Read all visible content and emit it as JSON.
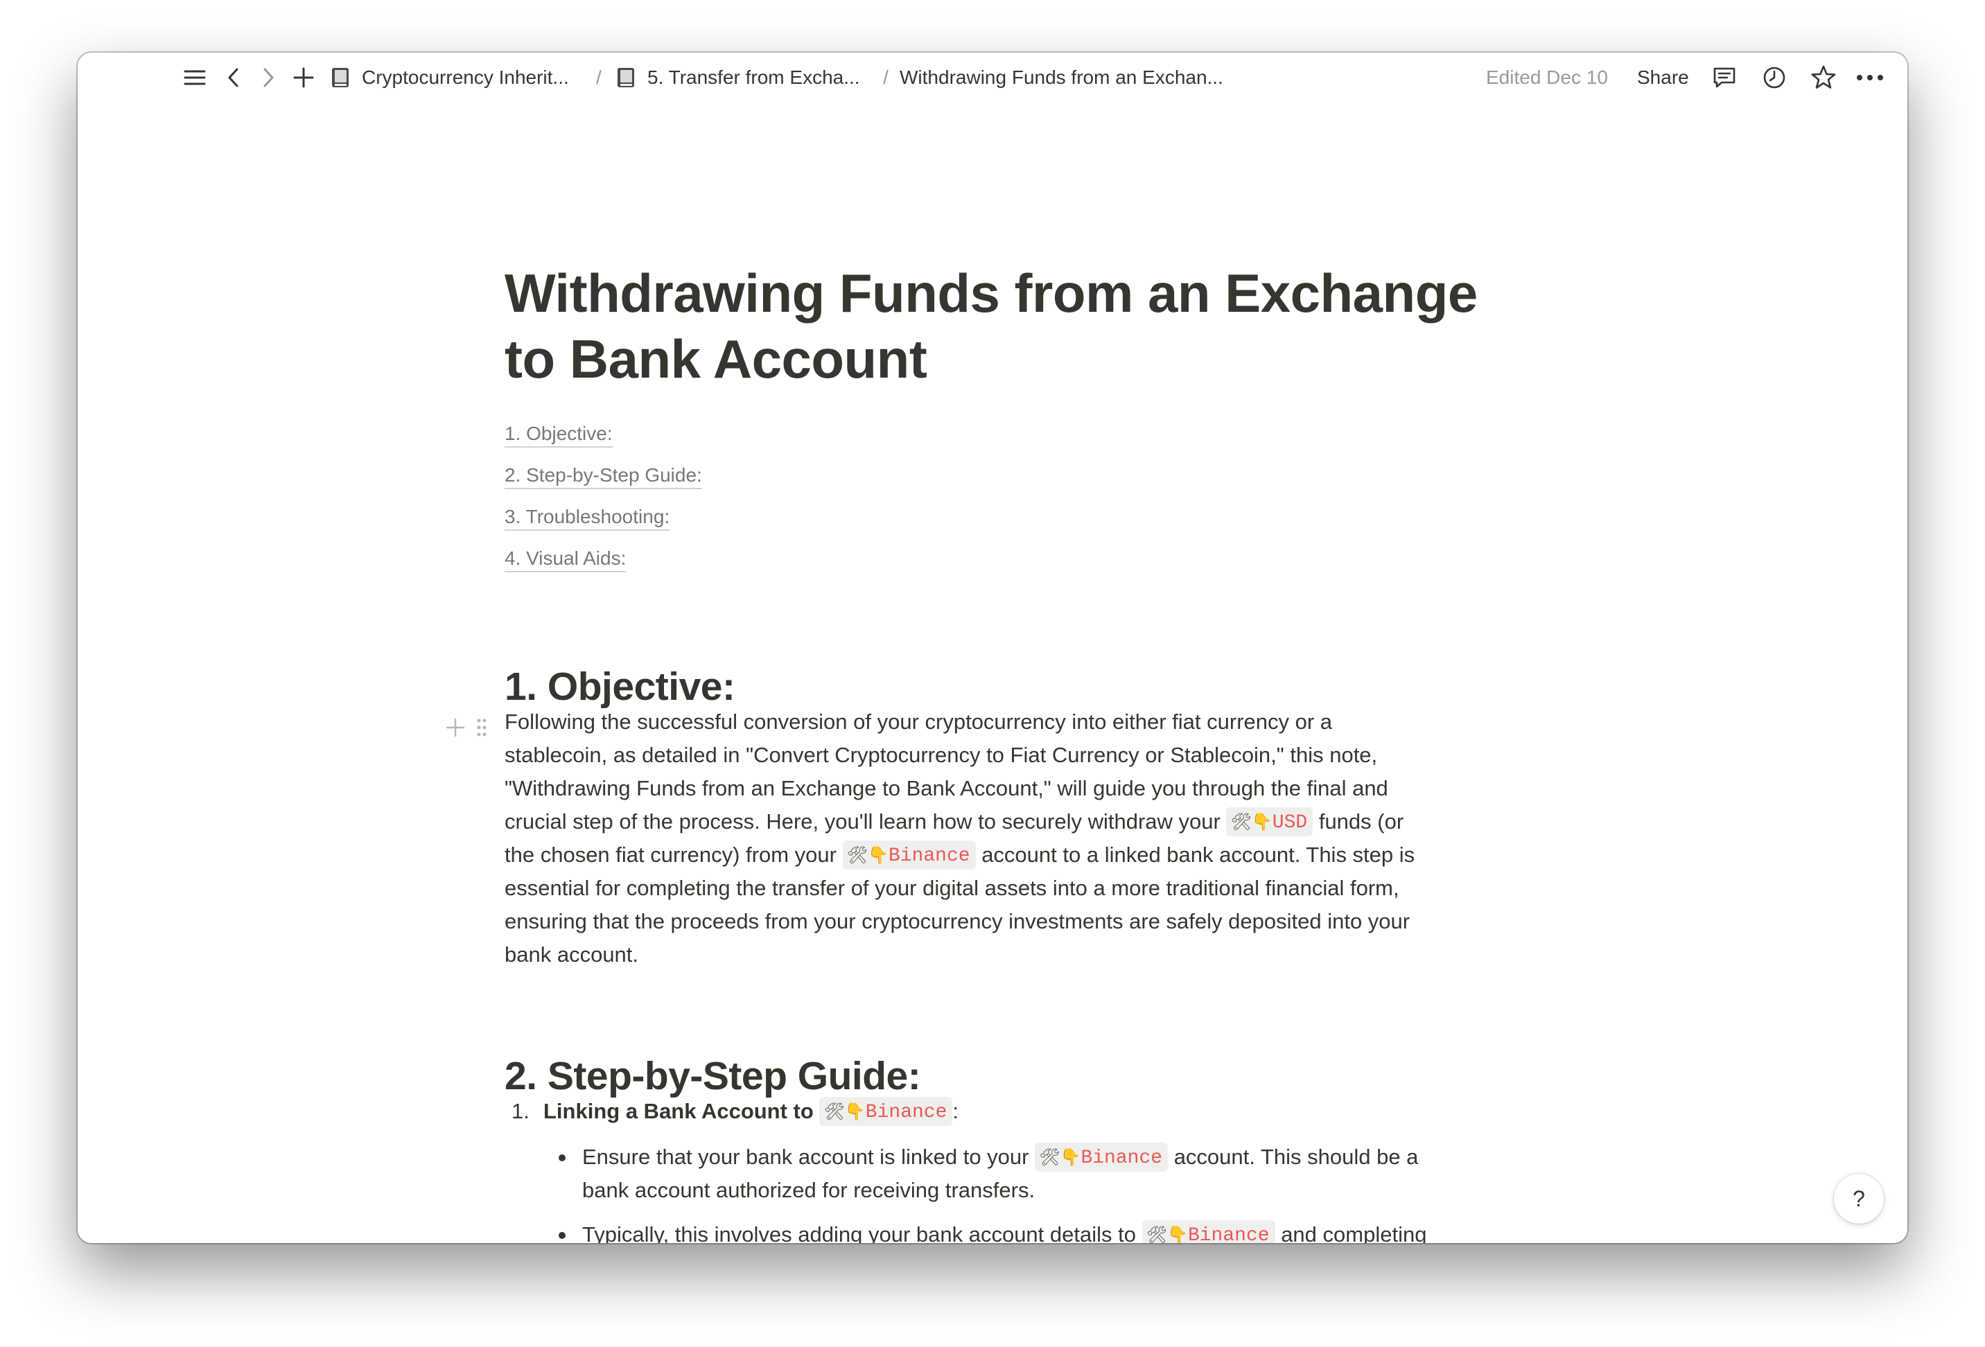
{
  "topbar": {
    "breadcrumbs": [
      {
        "label": "Cryptocurrency Inherit...",
        "icon": "book-icon"
      },
      {
        "label": "5. Transfer from Excha...",
        "icon": "book-icon"
      },
      {
        "label": "Withdrawing Funds from an Exchan..."
      }
    ],
    "separator": "/",
    "edited": "Edited Dec 10",
    "share_label": "Share"
  },
  "page": {
    "title_line1": "Withdrawing Funds from an Exchange",
    "title_line2": "to Bank Account",
    "toc": [
      "1. Objective:",
      "2. Step-by-Step Guide:",
      "3. Troubleshooting:",
      "4. Visual Aids:"
    ],
    "sections": {
      "objective": {
        "heading": "1. Objective:",
        "lines": [
          "Following the successful conversion of your cryptocurrency into either fiat currency or a",
          "stablecoin, as detailed in \"Convert Cryptocurrency to Fiat Currency or Stablecoin,\" this note,",
          "\"Withdrawing Funds from an Exchange to Bank Account,\" will guide you through the final and",
          "crucial step of the process. Here, you'll learn how to securely withdraw your ",
          " funds (or",
          "the chosen fiat currency) from your ",
          " account to a linked bank account. This step is",
          "essential for completing the transfer of your digital assets into a more traditional financial form,",
          "ensuring that the proceeds from your cryptocurrency investments are safely deposited into your",
          "bank account."
        ],
        "chip_usd": "USD",
        "chip_binance": "Binance"
      },
      "guide": {
        "heading": "2. Step-by-Step Guide:",
        "item1_num": "1.",
        "item1_label": "Linking a Bank Account to ",
        "item1_chip": "Binance",
        "item1_colon": ":",
        "bullet1_a": "Ensure that your bank account is linked to your ",
        "bullet1_chip": "Binance",
        "bullet1_b": " account. This should be a",
        "bullet1_line2": "bank account authorized for receiving transfers.",
        "bullet2_a": "Typically, this involves adding your bank account details to ",
        "bullet2_chip": "Binance",
        "bullet2_b": " and completing"
      }
    }
  },
  "help_label": "?",
  "colors": {
    "text": "#37352f",
    "muted": "#9b9a97",
    "chip_text": "#eb5757",
    "chip_bg": "#efefed"
  },
  "icons": {
    "tool": "🛠",
    "hand": "👇"
  }
}
